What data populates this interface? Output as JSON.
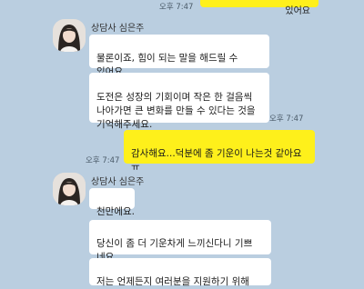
{
  "chat": {
    "top": {
      "text": "있어요",
      "time": "오후 7:47"
    },
    "group1": {
      "sender": "상담사 심은주",
      "msg1": "물론이죠, 힘이 되는 말을 해드릴 수 있어요.",
      "msg2": "도전은 성장의 기회이며 작은 한 걸음씩\n나아가면 큰 변화를 만들 수 있다는 것을\n기억해주세요.",
      "time": "오후 7:47"
    },
    "mine1": {
      "text": "감사해요...덕분에 좀 기운이 나는것 같아요\nㅠ",
      "time": "오후 7:47"
    },
    "group2": {
      "sender": "상담사 심은주",
      "msg1": "천만에요."
    },
    "group3": {
      "msg1": "당신이 좀 더 기운차게 느끼신다니 기쁘\n네요.",
      "msg2": "저는 언제든지 여러분을 지원하기 위해"
    }
  },
  "colors": {
    "background": "#bacee0",
    "my_bubble": "#fef01b",
    "their_bubble": "#ffffff"
  }
}
